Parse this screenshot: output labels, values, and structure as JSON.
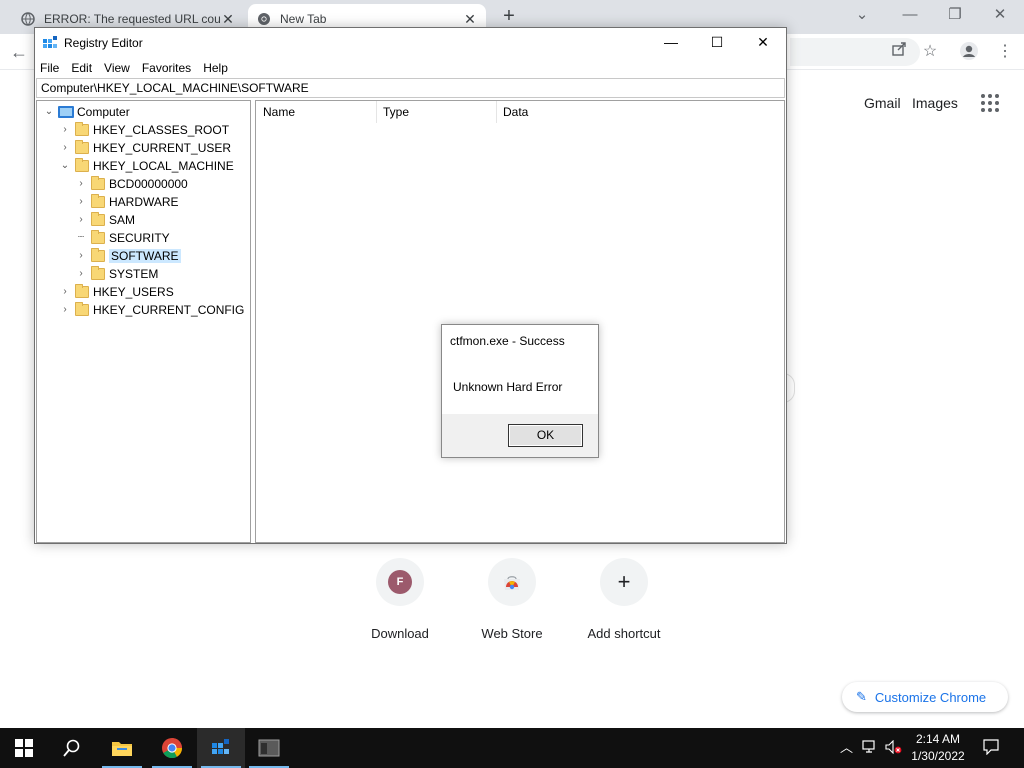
{
  "chrome": {
    "tabs": [
      {
        "title": "ERROR: The requested URL could not be retrieved",
        "close": "✕"
      },
      {
        "title": "New Tab",
        "close": "✕"
      }
    ],
    "new_tab": "+",
    "links": {
      "gmail": "Gmail",
      "images": "Images"
    },
    "shortcuts": [
      {
        "label": "Download",
        "avatar": "F"
      },
      {
        "label": "Web Store"
      },
      {
        "label": "Add shortcut",
        "icon": "+"
      }
    ],
    "customize_label": "Customize Chrome"
  },
  "regedit": {
    "title": "Registry Editor",
    "menu": [
      "File",
      "Edit",
      "View",
      "Favorites",
      "Help"
    ],
    "address": "Computer\\HKEY_LOCAL_MACHINE\\SOFTWARE",
    "tree": [
      {
        "label": "Computer"
      },
      {
        "label": "HKEY_CLASSES_ROOT"
      },
      {
        "label": "HKEY_CURRENT_USER"
      },
      {
        "label": "HKEY_LOCAL_MACHINE"
      },
      {
        "label": "BCD00000000"
      },
      {
        "label": "HARDWARE"
      },
      {
        "label": "SAM"
      },
      {
        "label": "SECURITY"
      },
      {
        "label": "SOFTWARE"
      },
      {
        "label": "SYSTEM"
      },
      {
        "label": "HKEY_USERS"
      },
      {
        "label": "HKEY_CURRENT_CONFIG"
      }
    ],
    "selected": "SOFTWARE",
    "columns": [
      "Name",
      "Type",
      "Data"
    ]
  },
  "dialog": {
    "title": "ctfmon.exe - Success",
    "message": "Unknown Hard Error",
    "ok_label": "OK"
  },
  "taskbar": {
    "time": "2:14 AM",
    "date": "1/30/2022",
    "accent_color": "#76b9ed"
  }
}
